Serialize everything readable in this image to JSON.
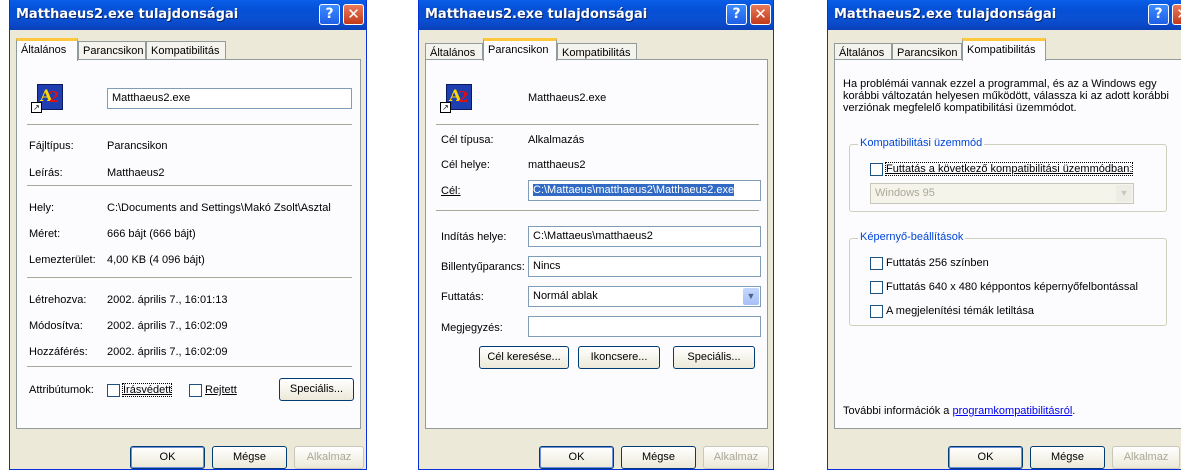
{
  "dialogs": [
    {
      "title": "Matthaeus2.exe tulajdonságai",
      "help": "?",
      "close": "✕",
      "tabs": [
        "Általános",
        "Parancsikon",
        "Kompatibilitás"
      ]
    },
    {
      "title": "Matthaeus2.exe tulajdonságai",
      "help": "?",
      "close": "✕",
      "tabs": [
        "Általános",
        "Parancsikon",
        "Kompatibilitás"
      ]
    },
    {
      "title": "Matthaeus2.exe tulajdonságai",
      "help": "?",
      "close": "✕",
      "tabs": [
        "Általános",
        "Parancsikon",
        "Kompatibilitás"
      ]
    }
  ],
  "general": {
    "name_value": "Matthaeus2.exe",
    "filetype_label": "Fájltípus:",
    "filetype_value": "Parancsikon",
    "desc_label": "Leírás:",
    "desc_value": "Matthaeus2",
    "location_label": "Hely:",
    "location_value": "C:\\Documents and Settings\\Makó Zsolt\\Asztal",
    "size_label": "Méret:",
    "size_value": "666 bájt (666 bájt)",
    "disk_label": "Lemezterület:",
    "disk_value": "4,00 KB (4 096 bájt)",
    "created_label": "Létrehozva:",
    "created_value": "2002. április 7., 16:01:13",
    "modified_label": "Módosítva:",
    "modified_value": "2002. április 7., 16:02:09",
    "accessed_label": "Hozzáférés:",
    "accessed_value": "2002. április 7., 16:02:09",
    "attrs_label": "Attribútumok:",
    "readonly_label": "Írásvédett",
    "hidden_label": "Rejtett",
    "special_button": "Speciális..."
  },
  "shortcut": {
    "name_value": "Matthaeus2.exe",
    "target_type_label": "Cél típusa:",
    "target_type_value": "Alkalmazás",
    "target_loc_label": "Cél helye:",
    "target_loc_value": "matthaeus2",
    "target_label": "Cél:",
    "target_value": "C:\\Mattaeus\\matthaeus2\\Matthaeus2.exe",
    "start_in_label": "Indítás helye:",
    "start_in_value": "C:\\Mattaeus\\matthaeus2",
    "hotkey_label": "Billentyűparancs:",
    "hotkey_value": "Nincs",
    "run_label": "Futtatás:",
    "run_value": "Normál ablak",
    "comment_label": "Megjegyzés:",
    "comment_value": "",
    "find_target_button": "Cél keresése...",
    "change_icon_button": "Ikoncsere...",
    "advanced_button": "Speciális..."
  },
  "compat": {
    "intro": "Ha problémái vannak ezzel a programmal, és az a Windows egy korábbi változatán helyesen működött, válassza ki az adott korábbi verziónak megfelelő kompatibilitási üzemmódot.",
    "mode_group": "Kompatibilitási üzemmód",
    "mode_check": "Futtatás a következő kompatibilitási üzemmódban:",
    "mode_value": "Windows 95",
    "display_group": "Képernyő-beállítások",
    "opt_256": "Futtatás 256 színben",
    "opt_640": "Futtatás 640 x 480 képpontos képernyőfelbontással",
    "opt_themes": "A megjelenítési témák letiltása",
    "more_info_prefix": "További információk a ",
    "more_info_link": "programkompatibilitásról",
    "more_info_suffix": "."
  },
  "buttons": {
    "ok": "OK",
    "cancel": "Mégse",
    "apply": "Alkalmaz"
  },
  "colors": {
    "titlebar": "#0a5ee8",
    "face": "#ece9d8",
    "selection": "#316ac5",
    "tab_highlight": "#ffc83c"
  }
}
